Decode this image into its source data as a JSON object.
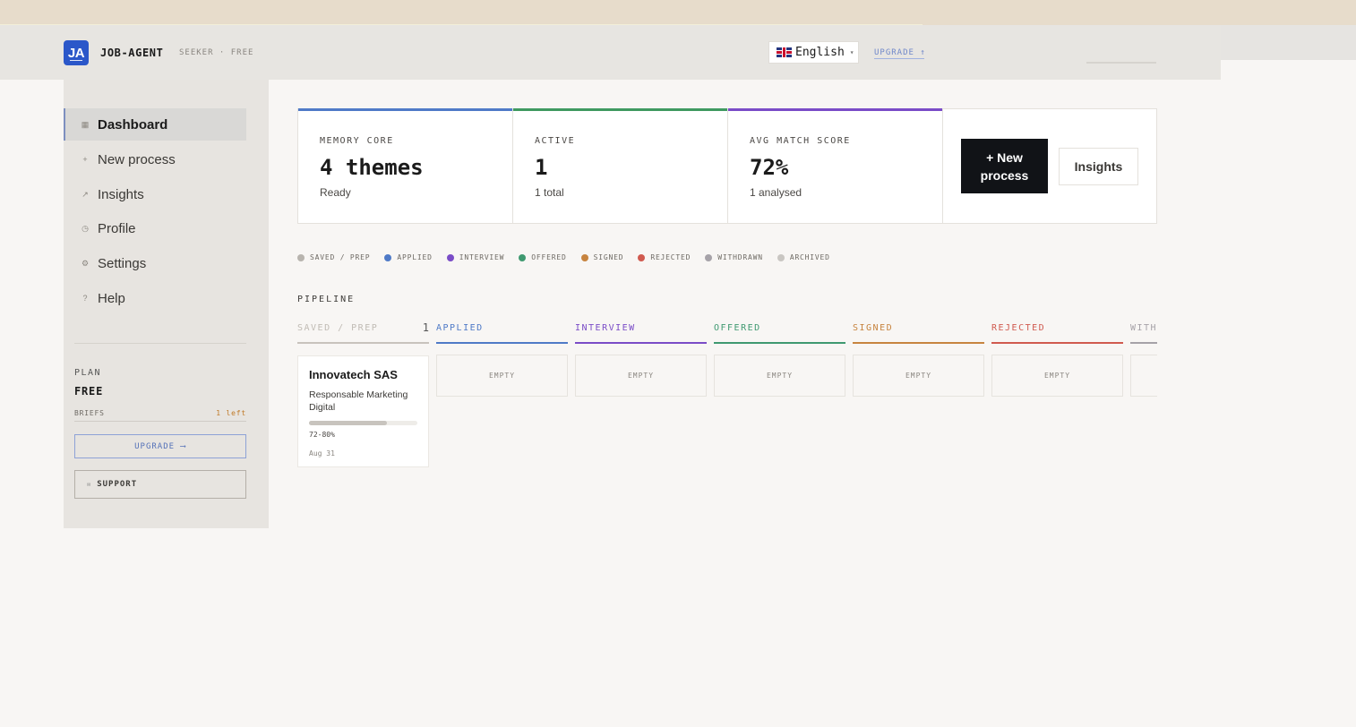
{
  "header": {
    "logo_text": "JA",
    "brand": "JOB-AGENT",
    "tier": "SEEKER · FREE",
    "language": "English",
    "upgrade_label": "UPGRADE ↑"
  },
  "sidebar": {
    "items": [
      {
        "label": "Dashboard",
        "icon": "grid-icon",
        "glyph": "▦"
      },
      {
        "label": "New process",
        "icon": "plus-icon",
        "glyph": "+"
      },
      {
        "label": "Insights",
        "icon": "trend-icon",
        "glyph": "↗"
      },
      {
        "label": "Profile",
        "icon": "user-icon",
        "glyph": "◷"
      },
      {
        "label": "Settings",
        "icon": "gear-icon",
        "glyph": "⚙"
      },
      {
        "label": "Help",
        "icon": "help-icon",
        "glyph": "?"
      }
    ],
    "plan_label": "PLAN",
    "plan_value": "FREE",
    "briefs_label": "BRIEFS",
    "briefs_left": "1 left",
    "upgrade_button": "UPGRADE ⟶",
    "support_button": "SUPPORT"
  },
  "stats": [
    {
      "label": "MEMORY CORE",
      "value": "4 themes",
      "sub": "Ready",
      "color": "#4f7ac7"
    },
    {
      "label": "ACTIVE",
      "value": "1",
      "sub": "1 total",
      "color": "#3f9960"
    },
    {
      "label": "AVG MATCH SCORE",
      "value": "72%",
      "sub": "1 analysed",
      "color": "#7a4cc7"
    }
  ],
  "actions": {
    "new_process": "+ New process",
    "insights": "Insights"
  },
  "legend": [
    {
      "label": "SAVED / PREP",
      "color": "#b8b4ae"
    },
    {
      "label": "APPLIED",
      "color": "#4f7ac7"
    },
    {
      "label": "INTERVIEW",
      "color": "#7a4cc7"
    },
    {
      "label": "OFFERED",
      "color": "#3f9970"
    },
    {
      "label": "SIGNED",
      "color": "#c7843f"
    },
    {
      "label": "REJECTED",
      "color": "#d05a4f"
    },
    {
      "label": "WITHDRAWN",
      "color": "#a6a2a8"
    },
    {
      "label": "ARCHIVED",
      "color": "#c9c6c2"
    }
  ],
  "pipeline": {
    "title": "PIPELINE",
    "columns": [
      {
        "label": "SAVED / PREP",
        "count": "1",
        "color": "#c8c3bd",
        "text_color": "#c0bbb4"
      },
      {
        "label": "APPLIED",
        "color": "#4f7ac7",
        "text_color": "#4f7ac7",
        "empty": "EMPTY"
      },
      {
        "label": "INTERVIEW",
        "color": "#7a4cc7",
        "text_color": "#7a4cc7",
        "empty": "EMPTY"
      },
      {
        "label": "OFFERED",
        "color": "#3f9970",
        "text_color": "#3f9970",
        "empty": "EMPTY"
      },
      {
        "label": "SIGNED",
        "color": "#c7843f",
        "text_color": "#c7843f",
        "empty": "EMPTY"
      },
      {
        "label": "REJECTED",
        "color": "#d05a4f",
        "text_color": "#d05a4f",
        "empty": "EMPTY"
      },
      {
        "label": "WITH",
        "color": "#a6a2a8",
        "text_color": "#a6a2a8"
      }
    ],
    "card": {
      "company": "Innovatech SAS",
      "role": "Responsable Marketing Digital",
      "match_fraction": 0.72,
      "range": "72-80%",
      "date": "Aug 31"
    }
  }
}
